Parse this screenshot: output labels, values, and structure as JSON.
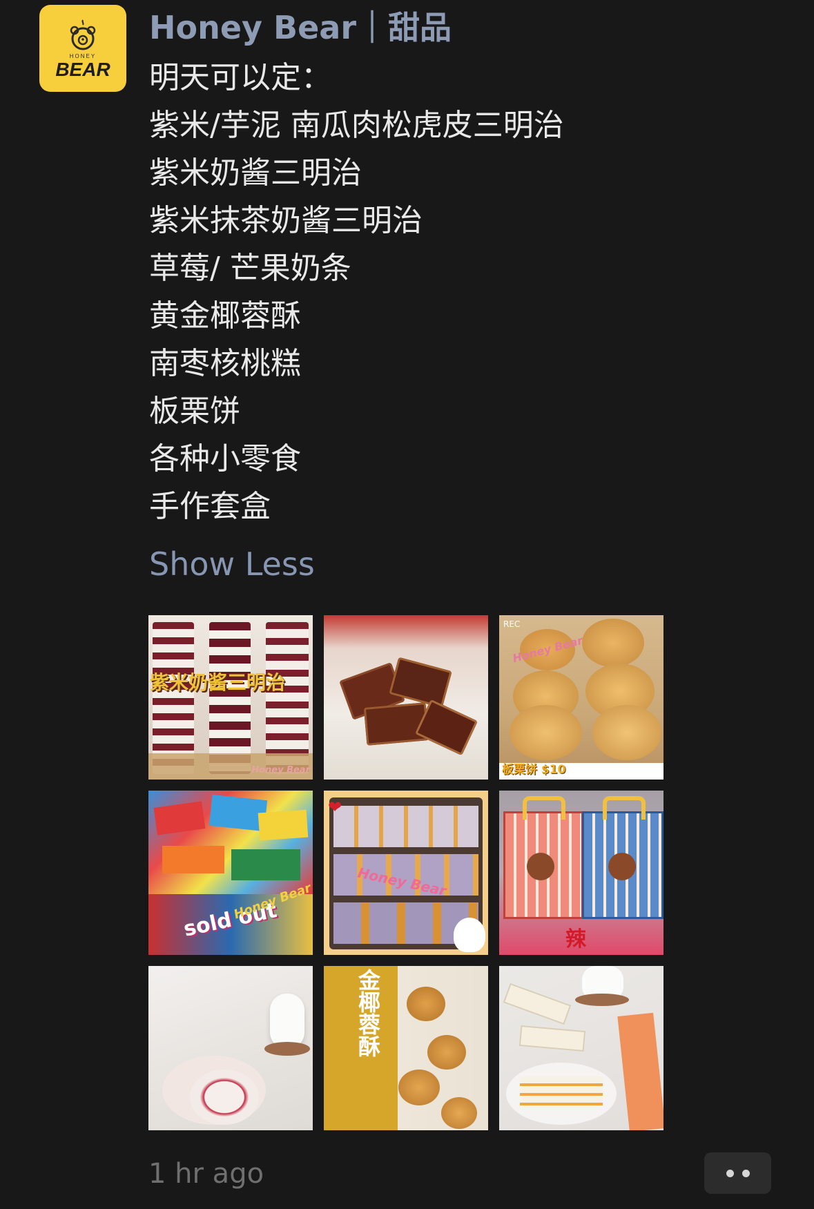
{
  "avatar": {
    "brand_small": "HONEY",
    "brand_big": "BEAR",
    "icon": "bear-icon",
    "color": "#f7cf3d"
  },
  "post": {
    "author": "Honey Bear｜甜品",
    "lines": [
      "明天可以定：",
      "紫米/芋泥 南瓜肉松虎皮三明治",
      "紫米奶酱三明治",
      "紫米抹茶奶酱三明治",
      "草莓/ 芒果奶条",
      "黄金椰蓉酥",
      "南枣核桃糕",
      "板栗饼",
      "各种小零食",
      "手作套盒"
    ],
    "show_less": "Show Less",
    "timestamp": "1 hr ago"
  },
  "photos": [
    {
      "name": "photo-sandwich-purple-rice",
      "overlay": "紫米奶酱三明治",
      "watermark": "Honey Bear"
    },
    {
      "name": "photo-jujube-walnut-cake"
    },
    {
      "name": "photo-chestnut-cookies",
      "overlay": "板栗饼 $10",
      "watermark": "Honey Bear",
      "badge": "REC"
    },
    {
      "name": "photo-snacks",
      "overlay": "sold out",
      "watermark": "Honey Bear"
    },
    {
      "name": "photo-taro-sandwiches",
      "watermark": "Honey Bear"
    },
    {
      "name": "photo-gift-boxes",
      "overlay": "辣"
    },
    {
      "name": "photo-cream-roll"
    },
    {
      "name": "photo-coconut-crisps",
      "overlay": "金椰蓉酥"
    },
    {
      "name": "photo-milk-bars"
    }
  ],
  "colors": {
    "background": "#181818",
    "author": "#8e9bb4",
    "link": "#8797b3",
    "timestamp": "#6f6f6f"
  }
}
